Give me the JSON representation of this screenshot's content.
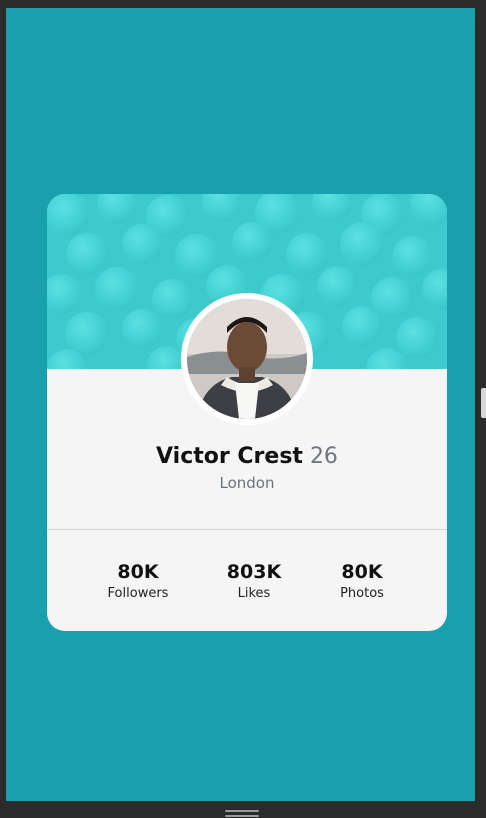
{
  "profile": {
    "name": "Victor Crest",
    "age": "26",
    "city": "London"
  },
  "stats": [
    {
      "value": "80K",
      "label": "Followers"
    },
    {
      "value": "803K",
      "label": "Likes"
    },
    {
      "value": "80K",
      "label": "Photos"
    }
  ],
  "colors": {
    "background": "#19a0ad",
    "header": "#40cfd1",
    "card": "#f5f5f5"
  },
  "icons": {
    "avatar": "person-photo",
    "bottom_handle": "hamburger-menu-icon"
  }
}
